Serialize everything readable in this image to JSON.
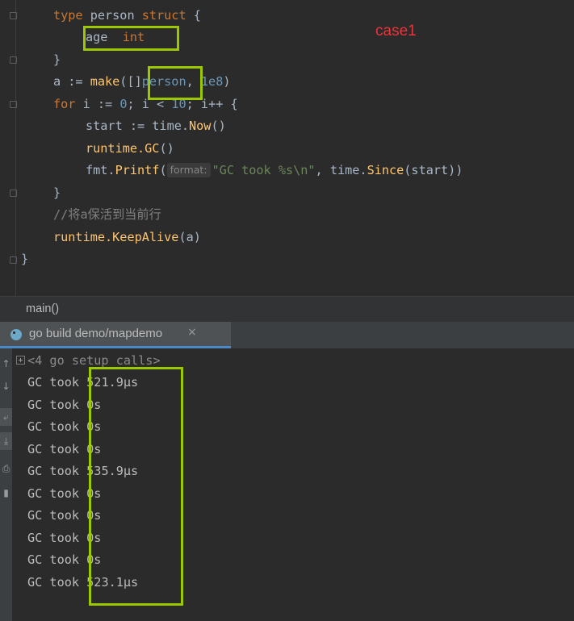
{
  "editor": {
    "lines": {
      "l1": {
        "kw": "type",
        "name": " person ",
        "kw2": "struct",
        "rest": " {"
      },
      "l2": {
        "field": "age",
        "type": "int"
      },
      "l3": "}",
      "l4": {
        "a": "a := ",
        "make": "make",
        "open": "([]",
        "type": "person",
        "sep": ", ",
        "num": "1e8",
        "close": ")"
      },
      "l5": {
        "for": "for",
        "mid": " i := ",
        "zero": "0",
        "mid2": "; i < ",
        "ten": "10",
        "end": "; i++ {"
      },
      "l6": {
        "start": "start := time.",
        "now": "Now",
        "paren": "()"
      },
      "l7": {
        "pkg": "runtime.",
        "gc": "GC",
        "paren": "()"
      },
      "l8": {
        "pkg": "fmt.",
        "printf": "Printf",
        "open": "(",
        "hint": "format:",
        "str": "\"GC took %s\\n\"",
        "sep": ", time.",
        "since": "Since",
        "args": "(start))"
      },
      "l9": "}",
      "l10": "//将a保活到当前行",
      "l11": {
        "pkg": "runtime.",
        "keepalive": "KeepAlive",
        "args": "(a)"
      },
      "l12": "}"
    },
    "annotation_label": "case1",
    "highlight_color": "#9bc800",
    "annotation_color": "#e8343b"
  },
  "breadcrumb": {
    "label": "main()"
  },
  "run_panel": {
    "tab_title": "go build demo/mapdemo",
    "close_glyph": "×",
    "setup_calls": "<4 go setup calls>",
    "output": [
      {
        "prefix": "GC took ",
        "value": "521.9µs"
      },
      {
        "prefix": "GC took ",
        "value": "0s"
      },
      {
        "prefix": "GC took ",
        "value": "0s"
      },
      {
        "prefix": "GC took ",
        "value": "0s"
      },
      {
        "prefix": "GC took ",
        "value": "535.9µs"
      },
      {
        "prefix": "GC took ",
        "value": "0s"
      },
      {
        "prefix": "GC took ",
        "value": "0s"
      },
      {
        "prefix": "GC took ",
        "value": "0s"
      },
      {
        "prefix": "GC took ",
        "value": "0s"
      },
      {
        "prefix": "GC took ",
        "value": "523.1µs"
      }
    ],
    "tools": [
      "up-arrow-icon",
      "down-arrow-icon",
      "soft-wrap-icon",
      "scroll-to-end-icon",
      "print-icon",
      "trash-icon"
    ]
  }
}
